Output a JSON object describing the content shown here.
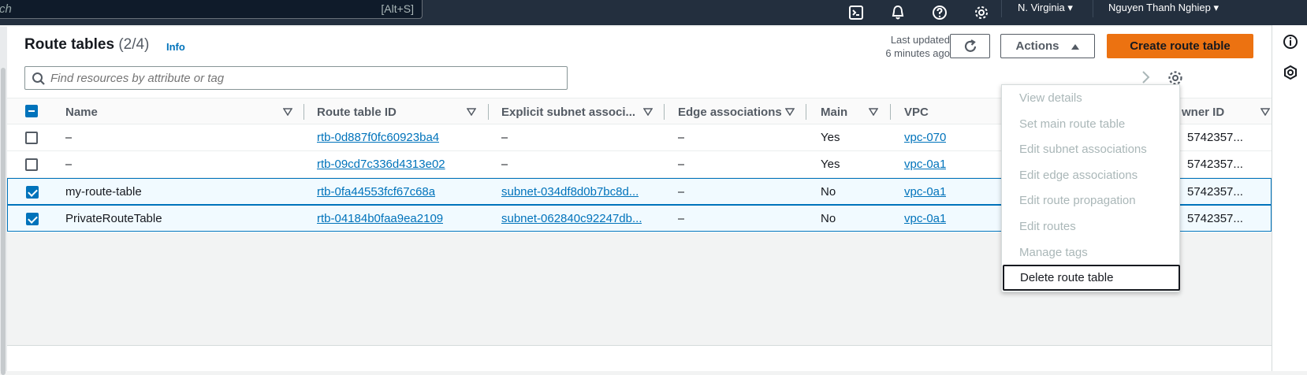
{
  "topnav": {
    "search_placeholder": "ch",
    "search_shortcut": "[Alt+S]",
    "region": "N. Virginia",
    "user": "Nguyen Thanh Nghiep",
    "icons": [
      "cloudshell-icon",
      "bell-icon",
      "help-icon",
      "settings-icon"
    ]
  },
  "header": {
    "title": "Route tables",
    "count": "(2/4)",
    "info": "Info",
    "last_updated_label": "Last updated",
    "last_updated_value": "6 minutes ago",
    "actions_label": "Actions",
    "create_label": "Create route table"
  },
  "filter": {
    "placeholder": "Find resources by attribute or tag"
  },
  "table": {
    "columns": [
      "Name",
      "Route table ID",
      "Explicit subnet associ...",
      "Edge associations",
      "Main",
      "VPC",
      "wner ID"
    ],
    "rows": [
      {
        "selected": false,
        "name": "–",
        "id": "rtb-0d887f0fc60923ba4",
        "subnet": "–",
        "edge": "–",
        "main": "Yes",
        "vpc": "vpc-070",
        "owner": "5742357..."
      },
      {
        "selected": false,
        "name": "–",
        "id": "rtb-09cd7c336d4313e02",
        "subnet": "–",
        "edge": "–",
        "main": "Yes",
        "vpc": "vpc-0a1",
        "owner": "5742357..."
      },
      {
        "selected": true,
        "name": "my-route-table",
        "id": "rtb-0fa44553fcf67c68a",
        "subnet": "subnet-034df8d0b7bc8d...",
        "edge": "–",
        "main": "No",
        "vpc": "vpc-0a1",
        "owner": "5742357..."
      },
      {
        "selected": true,
        "name": "PrivateRouteTable",
        "id": "rtb-04184b0faa9ea2109",
        "subnet": "subnet-062840c92247db...",
        "edge": "–",
        "main": "No",
        "vpc": "vpc-0a1",
        "owner": "5742357..."
      }
    ]
  },
  "actions_menu": {
    "items": [
      {
        "label": "View details",
        "enabled": false
      },
      {
        "label": "Set main route table",
        "enabled": false
      },
      {
        "label": "Edit subnet associations",
        "enabled": false
      },
      {
        "label": "Edit edge associations",
        "enabled": false
      },
      {
        "label": "Edit route propagation",
        "enabled": false
      },
      {
        "label": "Edit routes",
        "enabled": false
      },
      {
        "label": "Manage tags",
        "enabled": false
      },
      {
        "label": "Delete route table",
        "enabled": true
      }
    ]
  },
  "colors": {
    "nav_bg": "#232f3e",
    "link": "#0073bb",
    "primary_button": "#ec7211",
    "selected_row_bg": "#f1faff"
  }
}
